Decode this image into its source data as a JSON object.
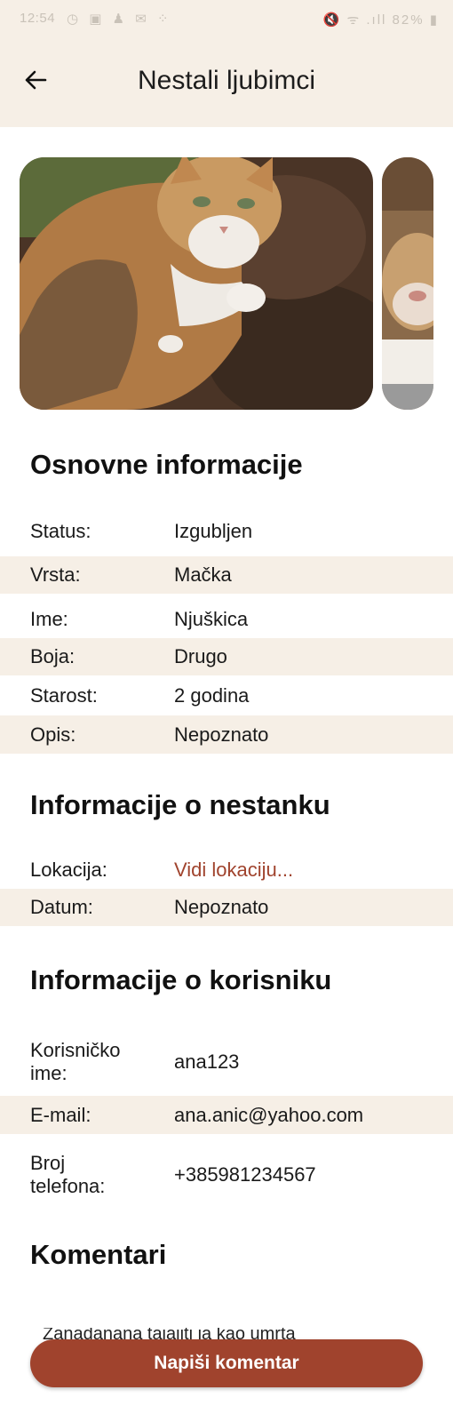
{
  "status_bar": {
    "time": "12:54",
    "left_icons": "◷ ▣ ♟ ✉ ⁘",
    "right_icons": "🔇 ᯤ .ıll 82% ▮"
  },
  "app_bar": {
    "title": "Nestali ljubimci",
    "back_icon": "arrow-left-icon"
  },
  "gallery": {
    "photos": [
      "cat-photo",
      "cat-photo-partial"
    ]
  },
  "basic_info": {
    "title": "Osnovne informacije",
    "rows": [
      {
        "label": "Status:",
        "value": "Izgubljen"
      },
      {
        "label": "Vrsta:",
        "value": "Mačka"
      },
      {
        "label": "Ime:",
        "value": "Njuškica"
      },
      {
        "label": "Boja:",
        "value": "Drugo"
      },
      {
        "label": "Starost:",
        "value": "2 godina"
      },
      {
        "label": "Opis:",
        "value": "Nepoznato"
      }
    ]
  },
  "missing_info": {
    "title": "Informacije o nestanku",
    "rows": [
      {
        "label": "Lokacija:",
        "value": "Vidi lokaciju..."
      },
      {
        "label": "Datum:",
        "value": "Nepoznato"
      }
    ]
  },
  "user_info": {
    "title": "Informacije o korisniku",
    "rows": [
      {
        "label": "Korisničko ime:",
        "value": "ana123"
      },
      {
        "label": "E-mail:",
        "value": "ana.anic@yahoo.com"
      },
      {
        "label": "Broj telefona:",
        "value": "+385981234567"
      }
    ]
  },
  "comments": {
    "title": "Komentari",
    "peek_text": "Zanadanana tajajiti ja kao umrta",
    "button_label": "Napiši komentar"
  },
  "colors": {
    "accent": "#a0432d",
    "header_bg": "#f6efe6",
    "row_shade": "#f6efe6"
  }
}
